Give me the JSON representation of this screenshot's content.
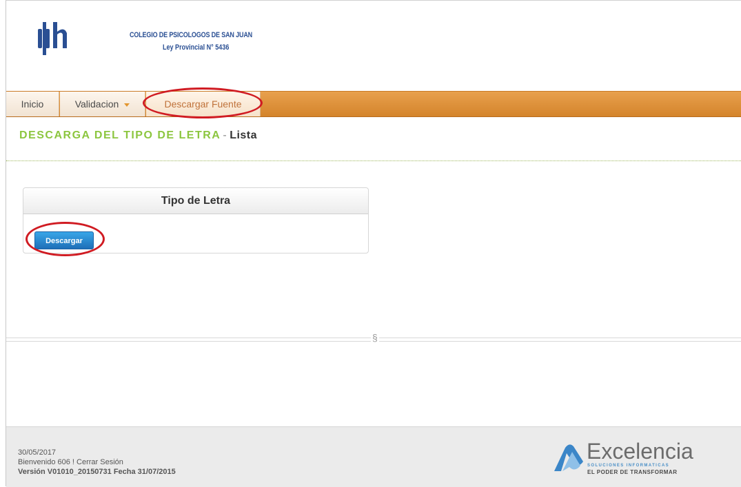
{
  "header": {
    "logo_text": "ψh",
    "org_name": "COLEGIO DE PSICOLOGOS DE SAN JUAN",
    "org_law": "Ley Provincial  N° 5436"
  },
  "nav": {
    "inicio": "Inicio",
    "validacion": "Validacion",
    "descargar_fuente": "Descargar Fuente"
  },
  "page": {
    "title_main": "DESCARGA DEL TIPO DE LETRA",
    "title_sep": "-",
    "title_sub": "Lista"
  },
  "panel": {
    "header": "Tipo de Letra",
    "button": "Descargar"
  },
  "divider_mark": "§",
  "footer": {
    "date": "30/05/2017",
    "welcome": "Bienvenido 606 ! Cerrar Sesión",
    "version": "Versión V01010_20150731 Fecha 31/07/2015"
  },
  "brand": {
    "name": "Excelencia",
    "sub": "SOLUCIONES INFORMATICAS",
    "tagline": "EL PODER DE TRANSFORMAR"
  },
  "colors": {
    "nav_bar": "#d4842b",
    "title_green": "#8cc63f",
    "button_blue": "#1e6fb8",
    "highlight_red": "#d01b22"
  }
}
